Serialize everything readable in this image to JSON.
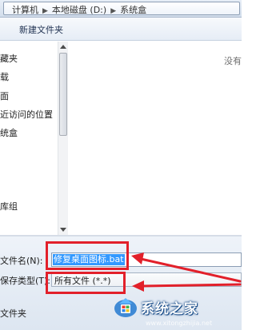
{
  "address_bar": {
    "crumbs": [
      "计算机",
      "本地磁盘 (D:)",
      "系统盒"
    ]
  },
  "toolbar": {
    "new_folder_label": "新建文件夹"
  },
  "sidebar": {
    "items": [
      "藏夹",
      "载",
      "面",
      "近访问的位置",
      "统盒",
      "库组",
      "算机"
    ]
  },
  "file_pane": {
    "empty_message": "没有"
  },
  "save_form": {
    "filename_label": "文件名(N):",
    "filename_value": "修复桌面图标.bat",
    "savetype_label": "保存类型(T):",
    "savetype_value": "所有文件 (*.*)",
    "browse_label": "文件夹"
  },
  "watermark": {
    "text": "系统之家",
    "url": "www.xitongzhijia.net"
  },
  "colors": {
    "highlight": "#e2202a",
    "selection": "#3399ff",
    "arrow": "#e2202a"
  }
}
